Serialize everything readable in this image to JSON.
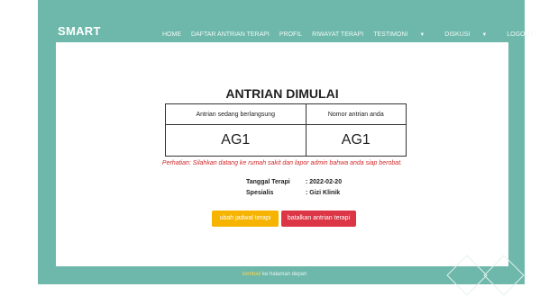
{
  "brand": "SMART",
  "nav": [
    {
      "label": "HOME"
    },
    {
      "label": "DAFTAR ANTRIAN TERAPI"
    },
    {
      "label": "PROFIL"
    },
    {
      "label": "RIWAYAT TERAPI"
    },
    {
      "label": "TESTIMONI",
      "dropdown": true
    },
    {
      "label": "DISKUSI",
      "dropdown": true
    },
    {
      "label": "LOGOUT"
    }
  ],
  "main": {
    "title": "ANTRIAN DIMULAI",
    "table": {
      "headers": [
        "Antrian sedang berlangsung",
        "Nomor antrian anda"
      ],
      "values": [
        "AG1",
        "AG1"
      ]
    },
    "warning": "Perhatian: Silahkan datang ke rumah sakit dan lapor admin bahwa anda siap berobat.",
    "info": [
      {
        "label": "Tanggal Terapi",
        "value": ": 2022-02-20"
      },
      {
        "label": "Spesialis",
        "value": ": Gizi Klinik"
      }
    ],
    "buttons": {
      "reschedule": "ubah jadwal terapi",
      "cancel": "batalkan antrian terapi"
    }
  },
  "footer": {
    "link": "kembali",
    "text": "ke halaman depan"
  },
  "colors": {
    "teal": "#6db8aa",
    "yellow": "#f6b400",
    "red": "#dc3545",
    "warning": "#d12a2a"
  }
}
